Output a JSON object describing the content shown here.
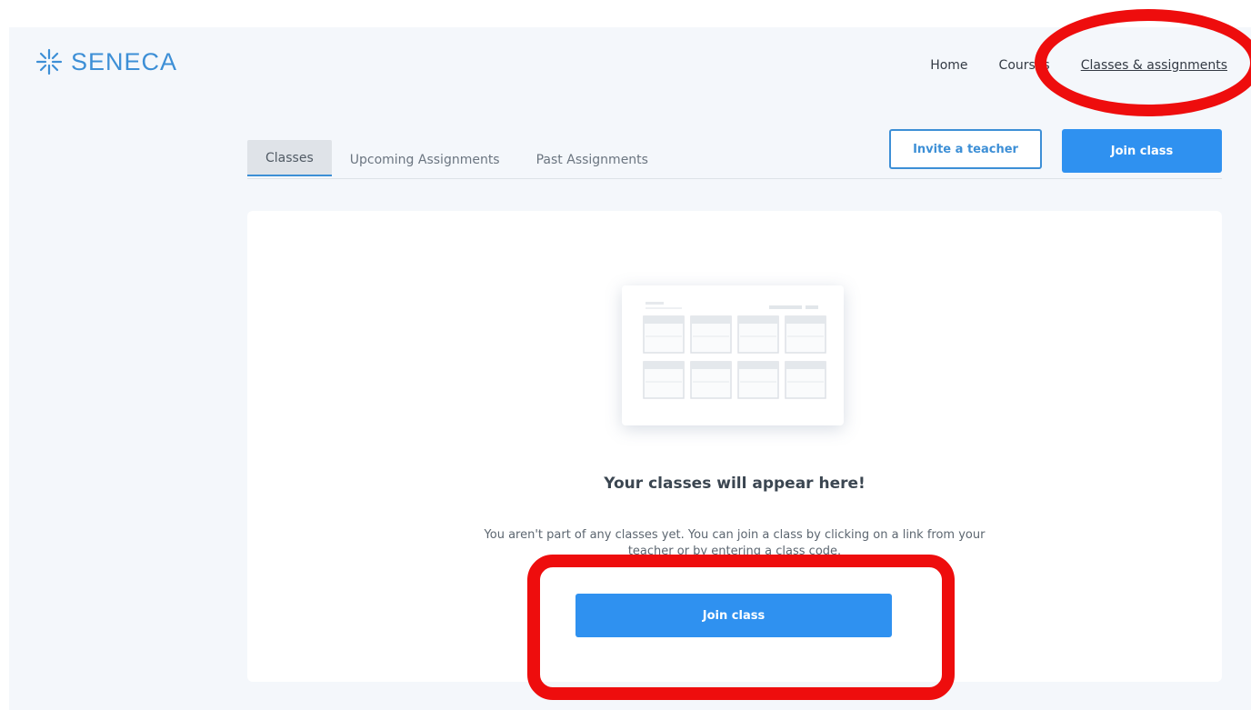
{
  "brand": {
    "name": "SENECA",
    "icon": "seneca-star-icon",
    "color": "#3d8fd6"
  },
  "nav": {
    "items": [
      {
        "label": "Home"
      },
      {
        "label": "Courses"
      },
      {
        "label": "Classes & assignments",
        "active": true
      }
    ]
  },
  "tabs": [
    {
      "label": "Classes",
      "active": true
    },
    {
      "label": "Upcoming Assignments"
    },
    {
      "label": "Past Assignments"
    }
  ],
  "actions": {
    "invite_label": "Invite a teacher",
    "join_label": "Join class"
  },
  "empty_state": {
    "illustration": "classes-grid-illustration",
    "title": "Your classes will appear here!",
    "description": "You aren't part of any classes yet. You can join a class by clicking on a link from your teacher or by entering a class code.",
    "button_label": "Join class"
  },
  "colors": {
    "accent": "#2f91f0",
    "highlight": "#ee0d0d",
    "background": "#f4f7fb"
  }
}
